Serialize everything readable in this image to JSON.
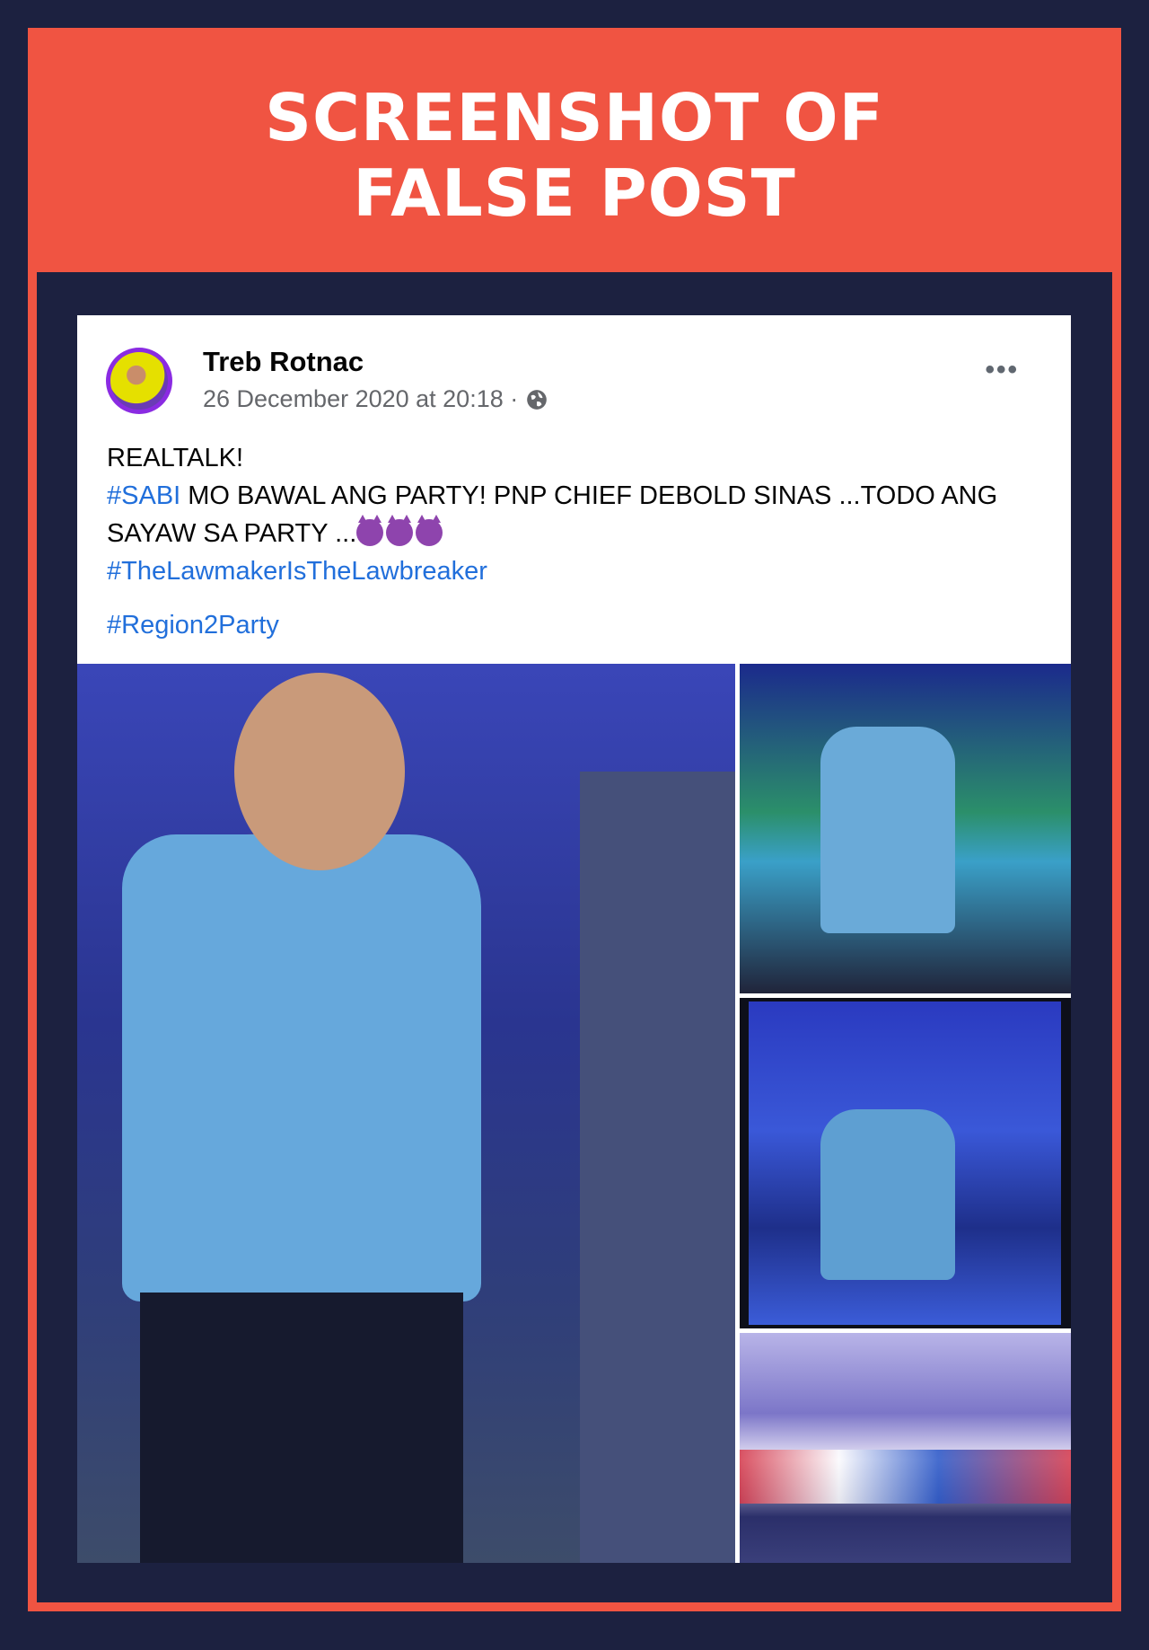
{
  "banner": {
    "line1": "SCREENSHOT OF",
    "line2": "FALSE POST",
    "background_color": "#f05442",
    "text_color": "#ffffff"
  },
  "post": {
    "author": "Treb Rotnac",
    "timestamp": "26 December 2020 at 20:18 ·",
    "privacy_icon": "globe-icon",
    "more_options_icon": "more-options-icon",
    "more_options_label": "•••",
    "text": {
      "line1": "REALTALK!",
      "hashtag_sabi": "#SABI",
      "line2_rest": " MO BAWAL ANG PARTY! PNP CHIEF DEBOLD SINAS ...TODO ANG SAYAW SA PARTY ...",
      "emoji_icon": "smiling-devil-emoji",
      "hashtag_lawmaker": "#TheLawmakerIsTheLawbreaker",
      "hashtag_region": "#Region2Party"
    },
    "hashtag_color": "#216fdb",
    "photos": [
      {
        "description_name": "main-photo"
      },
      {
        "description_name": "photo-top-right"
      },
      {
        "description_name": "photo-middle-right"
      },
      {
        "description_name": "photo-bottom-right"
      }
    ]
  }
}
